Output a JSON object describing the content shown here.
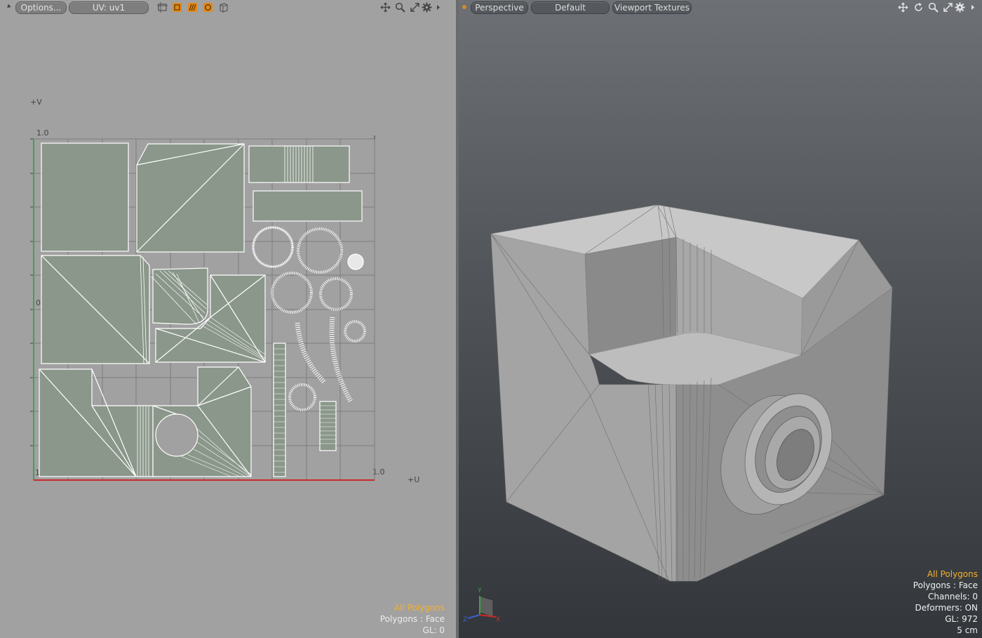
{
  "uv_view": {
    "toolbar": {
      "options_label": "Options...",
      "uv_map_label": "UV: uv1",
      "icons": [
        "uv-frame-icon",
        "uv-box-icon",
        "uv-stripes-icon",
        "uv-circle-icon",
        "uv-cube-icon"
      ],
      "nav_icons": [
        "move-icon",
        "zoom-icon",
        "fit-icon",
        "settings-icon",
        "play-icon"
      ]
    },
    "axis": {
      "v_label": "+V",
      "u_label": "+U",
      "v_max": "1.0",
      "u_max": "1.0",
      "origin_v": "0",
      "origin_u": "1"
    },
    "info": {
      "selection": "All Polygons",
      "mode": "Polygons : Face",
      "gl": "GL: 0"
    }
  },
  "perspective_view": {
    "toolbar": {
      "view_label": "Perspective",
      "shading_label": "Default",
      "texture_label": "Viewport Textures",
      "nav_icons": [
        "move-icon",
        "rotate-icon",
        "zoom-icon",
        "fit-icon",
        "settings-icon",
        "play-icon"
      ]
    },
    "info": {
      "selection": "All Polygons",
      "mode": "Polygons : Face",
      "channels": "Channels: 0",
      "deformers": "Deformers: ON",
      "gl": "GL: 972",
      "scale": "5 cm"
    },
    "gizmo": {
      "y": "Y",
      "z": "Z",
      "x": "X"
    }
  },
  "colors": {
    "accent": "#f4b030",
    "uv_fill": "#8a978a",
    "u_axis": "#cc2a2a",
    "v_axis": "#3aa64a"
  }
}
